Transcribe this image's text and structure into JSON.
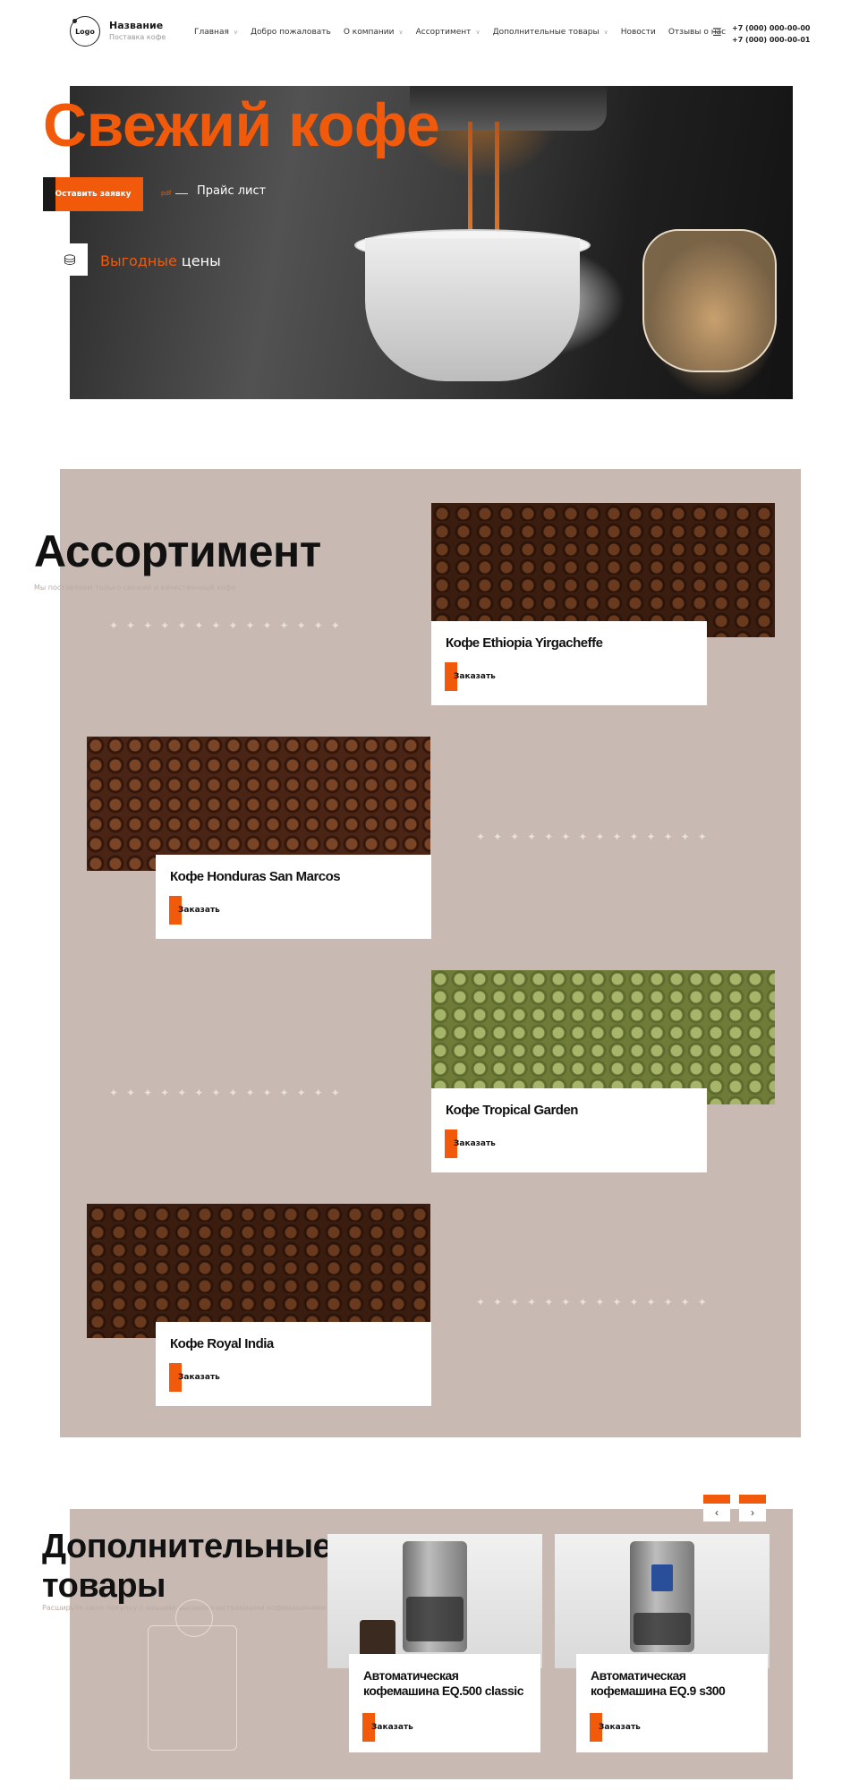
{
  "header": {
    "logo": "Logo",
    "brand_name": "Название",
    "brand_sub": "Поставка кофе",
    "nav": [
      {
        "label": "Главная",
        "dropdown": true
      },
      {
        "label": "Добро пожаловать",
        "dropdown": false
      },
      {
        "label": "О компании",
        "dropdown": true
      },
      {
        "label": "Ассортимент",
        "dropdown": true
      },
      {
        "label": "Дополнительные товары",
        "dropdown": true
      },
      {
        "label": "Новости",
        "dropdown": false
      },
      {
        "label": "Отзывы о нас",
        "dropdown": false
      }
    ],
    "phone_icon": "list-icon",
    "phones": [
      "+7 (000) 000-00-00",
      "+7 (000) 000-00-01"
    ]
  },
  "hero": {
    "title": "Свежий кофе",
    "cta_button": "Оставить заявку",
    "pdf_label": "pdf",
    "price_link": "Прайс лист",
    "benefit_icon": "coins-icon",
    "benefit_accent": "Выгодные",
    "benefit_rest": " цены"
  },
  "assortment": {
    "title": "Ассортимент",
    "subtitle": "Мы поставляем только свежий и качественный кофе",
    "order_label": "Заказать",
    "products": [
      {
        "name": "Кофе Ethiopia Yirgacheffe"
      },
      {
        "name": "Кофе Honduras San Marcos"
      },
      {
        "name": "Кофе Tropical Garden"
      },
      {
        "name": "Кофе Royal India"
      }
    ]
  },
  "extra": {
    "title_line1": "Дополнительные",
    "title_line2": "товары",
    "subtitle": "Расширьте свою покупку с нашими высококачественными кофемашинами",
    "order_label": "Заказать",
    "prev_icon": "chevron-left-icon",
    "next_icon": "chevron-right-icon",
    "products": [
      {
        "name": "Автоматическая кофемашина EQ.500 classic"
      },
      {
        "name": "Автоматическая кофемашина EQ.9 s300"
      }
    ]
  },
  "colors": {
    "accent": "#f05a0a",
    "section_bg": "#c8bab2",
    "dark": "#1a1a1a"
  }
}
